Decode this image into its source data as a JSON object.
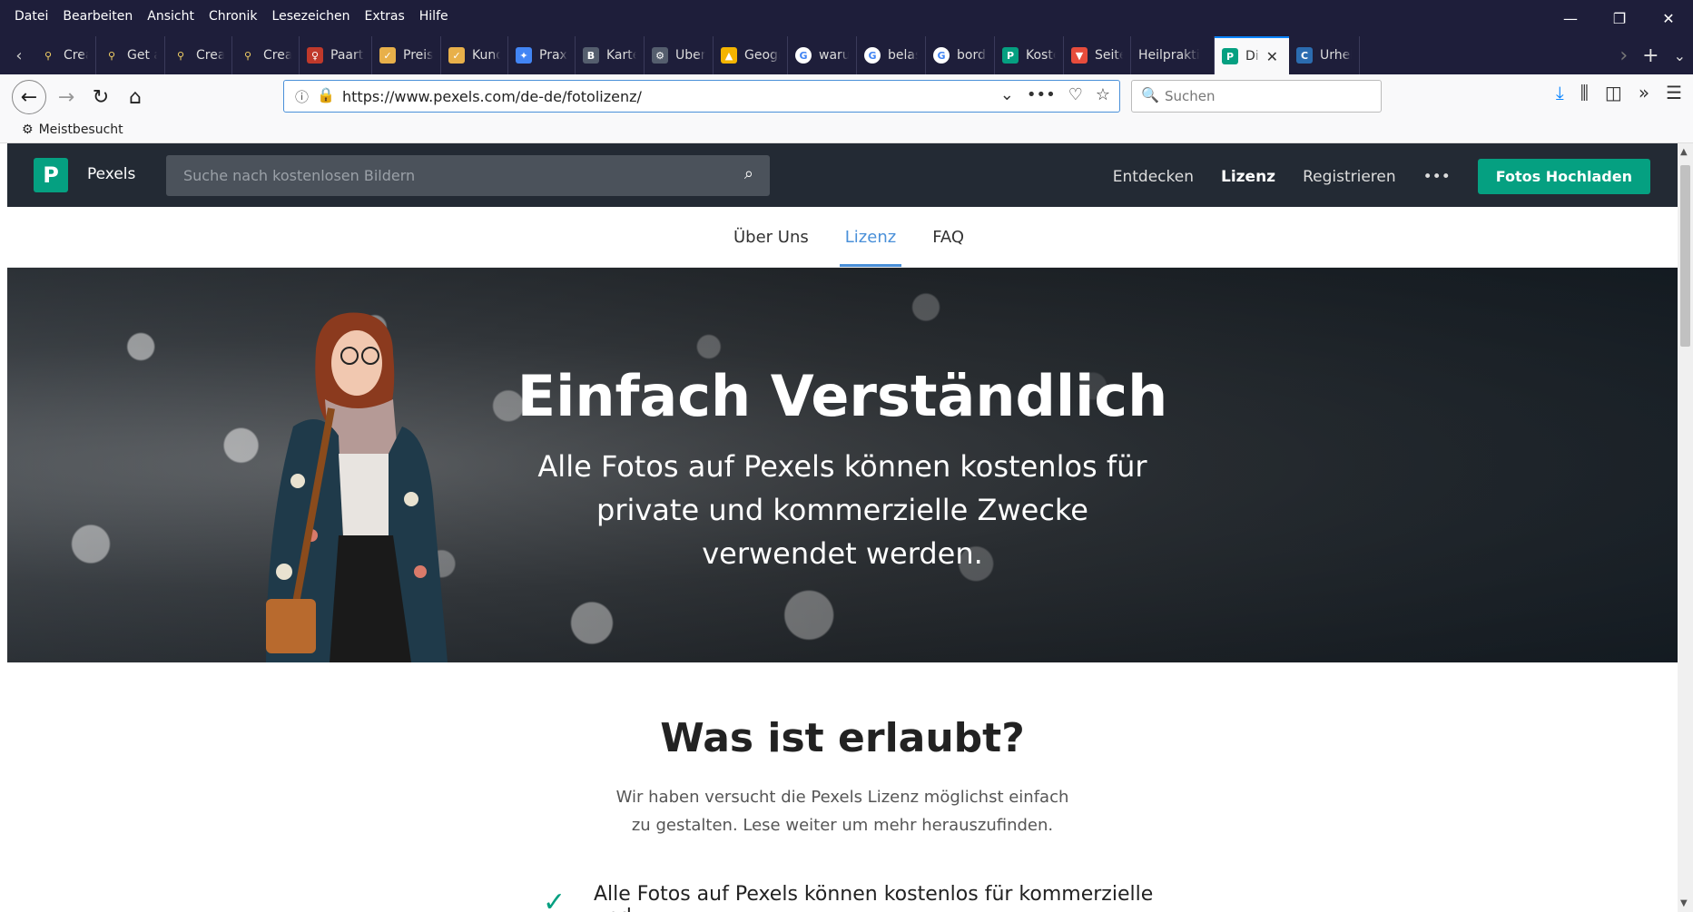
{
  "menubar": {
    "items": [
      "Datei",
      "Bearbeiten",
      "Ansicht",
      "Chronik",
      "Lesezeichen",
      "Extras",
      "Hilfe"
    ]
  },
  "tabs": [
    {
      "title": "Creati",
      "icon": "map-pin-icon",
      "color": "#1e1e3a"
    },
    {
      "title": "Get a",
      "icon": "map-pin-icon",
      "color": "#1e1e3a"
    },
    {
      "title": "Creati",
      "icon": "map-pin-icon",
      "color": "#1e1e3a"
    },
    {
      "title": "Creati",
      "icon": "map-pin-icon",
      "color": "#1e1e3a"
    },
    {
      "title": "Paarth",
      "icon": "portrait-icon",
      "color": "#c0392b"
    },
    {
      "title": "Preise",
      "icon": "check-square-icon",
      "color": "#e8b04a"
    },
    {
      "title": "Kunde",
      "icon": "check-square-icon",
      "color": "#e8b04a"
    },
    {
      "title": "Praxis",
      "icon": "maps-icon",
      "color": "#4285f4"
    },
    {
      "title": "Karte",
      "icon": "booking-icon",
      "color": "#555e6e"
    },
    {
      "title": "Überb",
      "icon": "gear-icon",
      "color": "#555e6e"
    },
    {
      "title": "Geogr",
      "icon": "drive-icon",
      "color": "#f4b400"
    },
    {
      "title": "warum",
      "icon": "google-icon",
      "color": "#ffffff"
    },
    {
      "title": "belast",
      "icon": "google-icon",
      "color": "#ffffff"
    },
    {
      "title": "borde",
      "icon": "google-icon",
      "color": "#ffffff"
    },
    {
      "title": "Koster",
      "icon": "pexels-icon",
      "color": "#05a081"
    },
    {
      "title": "Seite",
      "icon": "flag-icon",
      "color": "#e74c3c"
    },
    {
      "title": "Heilprakti",
      "icon": "",
      "color": ""
    },
    {
      "title": "Di",
      "icon": "pexels-icon",
      "color": "#05a081",
      "active": true
    },
    {
      "title": "Urheb",
      "icon": "c-icon",
      "color": "#2b6cb0"
    }
  ],
  "navbar": {
    "url": "https://www.pexels.com/de-de/fotolizenz/",
    "search_placeholder": "Suchen"
  },
  "bookmarks": {
    "most_visited": "Meistbesucht"
  },
  "site": {
    "brand": "Pexels",
    "logo_letter": "P",
    "search_placeholder": "Suche nach kostenlosen Bildern",
    "nav": {
      "discover": "Entdecken",
      "license": "Lizenz",
      "register": "Registrieren",
      "more": "•••",
      "upload": "Fotos Hochladen"
    },
    "subnav": {
      "about": "Über Uns",
      "license": "Lizenz",
      "faq": "FAQ"
    },
    "hero": {
      "title": "Einfach Verständlich",
      "subtitle": "Alle Fotos auf Pexels können kostenlos für private und kommerzielle Zwecke verwendet werden."
    },
    "section": {
      "title": "Was ist erlaubt?",
      "description": "Wir haben versucht die Pexels Lizenz möglichst einfach zu gestalten. Lese weiter um mehr herauszufinden."
    },
    "allowed_items": [
      "Alle Fotos auf Pexels können kostenlos für kommerzielle und"
    ]
  },
  "colors": {
    "chrome_dark": "#1e1e3a",
    "pexels_green": "#05a081",
    "header_dark": "#232a34",
    "active_blue": "#4a90d9"
  }
}
